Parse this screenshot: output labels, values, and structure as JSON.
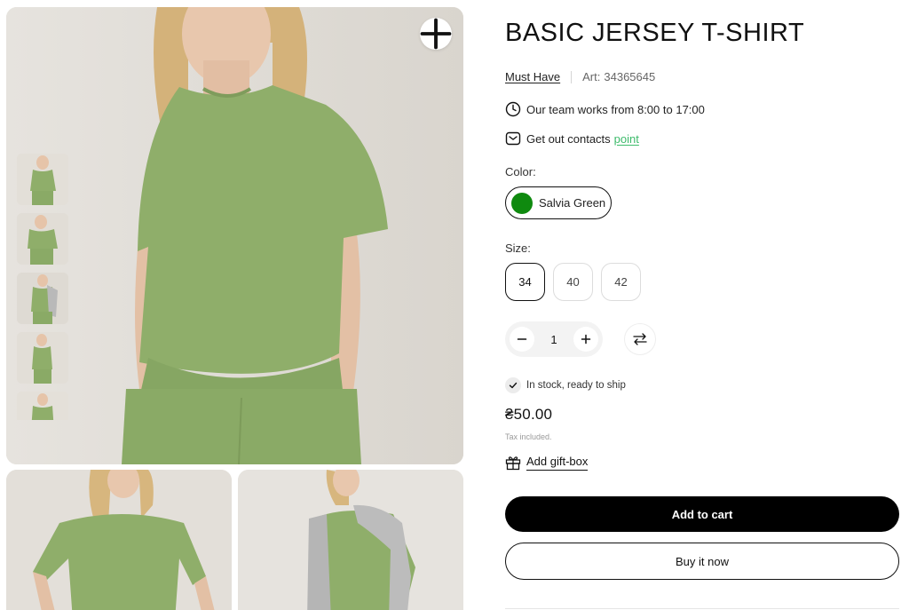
{
  "gallery": {
    "zoom_icon": "plus-icon",
    "thumbnail_count": 5,
    "colors": {
      "background": "#e4e1db",
      "shirt": "#8fae6a",
      "skin": "#e7c6ad",
      "hair": "#d9b57a"
    }
  },
  "product": {
    "title": "BASIC JERSEY T-SHIRT",
    "brand": "Must Have",
    "art_label": "Art:",
    "art_number": "34365645",
    "hours_text": "Our team works from 8:00 to 17:00",
    "contacts_text": "Get out contacts",
    "contacts_link": "point",
    "color_label": "Color:",
    "color": {
      "name": "Salvia Green",
      "swatch": "#0f8a0f"
    },
    "size_label": "Size:",
    "sizes": [
      {
        "label": "34",
        "selected": true
      },
      {
        "label": "40",
        "selected": false
      },
      {
        "label": "42",
        "selected": false
      }
    ],
    "quantity": "1",
    "stock_text": "In stock, ready to ship",
    "price": "₴50.00",
    "tax_note": "Tax included.",
    "gift_label": "Add gift-box",
    "add_to_cart": "Add to cart",
    "buy_now": "Buy it now"
  },
  "colors": {
    "accent_link": "#3dbb6b",
    "primary_button": "#000000"
  }
}
